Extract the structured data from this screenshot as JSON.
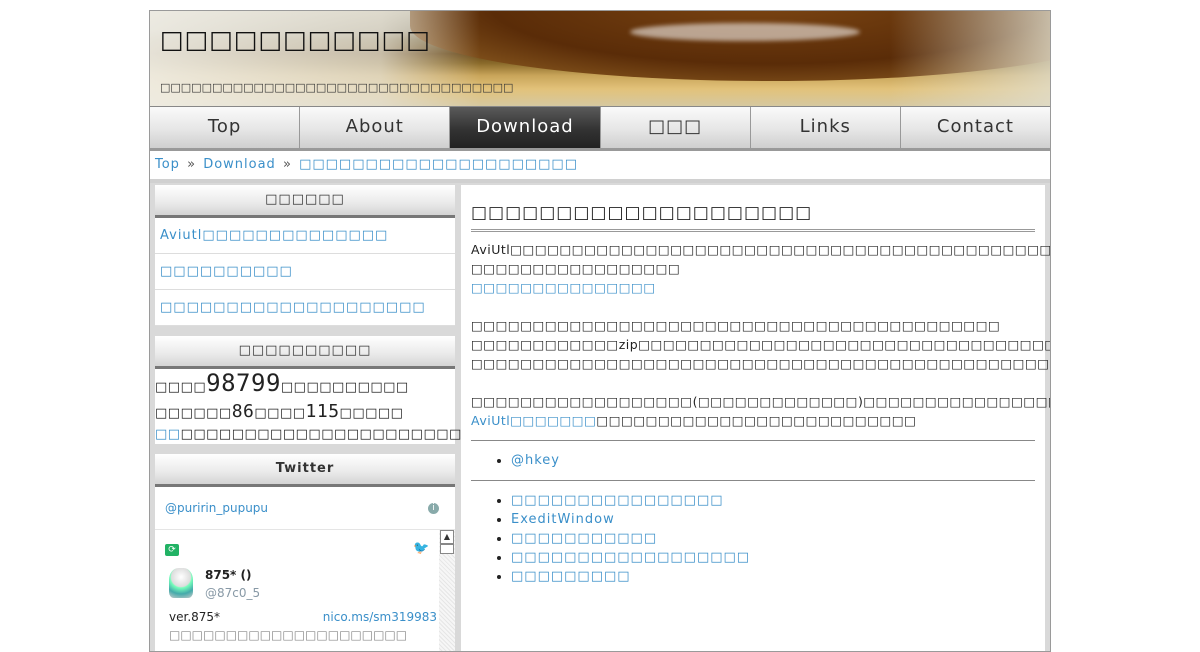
{
  "header": {
    "site_title": "□□□□□□□□□□□",
    "site_desc": "□□□□□□□□□□□□□□□□□□□□□□□□□□□□□□□□□□"
  },
  "nav": {
    "items": [
      "Top",
      "About",
      "Download",
      "□□□",
      "Links",
      "Contact"
    ],
    "active": "Download"
  },
  "breadcrumb": {
    "top": "Top",
    "download": "Download",
    "current": "□□□□□□□□□□□□□□□□□□□□□",
    "sep": "»"
  },
  "sidebar": {
    "categories": {
      "title": "□□□□□□",
      "links": [
        "Aviutl□□□□□□□□□□□□□□",
        "□□□□□□□□□□",
        "□□□□□□□□□□□□□□□□□□□□"
      ]
    },
    "counter": {
      "title": "□□□□□□□□□□",
      "prefix": "□□□□",
      "total": "98799",
      "total_suffix": "□□□□□□□□□□",
      "today_prefix": "□□□□□□",
      "today": "86",
      "yesterday_prefix": "□□□□",
      "yesterday": "115",
      "yesterday_suffix": "□□□□□",
      "link": "□□",
      "tail": "□□□□□□□□□□□□□□□□□□□□□□□□"
    },
    "twitter": {
      "title": "Twitter",
      "account": "@puririn_pupupu",
      "tweet": {
        "name": "875* ()",
        "handle": "@87c0_5",
        "text": "ver.875*",
        "link": "nico.ms/sm319983",
        "text2": "□□□□□□□□□□□□□□□□□□□□□"
      }
    }
  },
  "main": {
    "title": "□□□□□□□□□□□□□□□□□□□□",
    "p1_line1": "AviUtl□□□□□□□□□□□□□□□□□□□□□□□□□□□□□□□□□□□□□□□□□□□□□AviUtl□□□□□□□□□□□□□□□□□□□□",
    "p1_line2": "□□□□□□□□□□□□□□□□□",
    "p1_link": "□□□□□□□□□□□□□□□",
    "p2_line1": "□□□□□□□□□□□□□□□□□□□□□□□□□□□□□□□□□□□□□□□□□□□",
    "p2_line2": "□□□□□□□□□□□□zip□□□□□□□□□□□□□□□□□□□□□□□□□□□□□□□□□□□□□□□□□□□□□□□□□□□□□□□□□□□□□",
    "p2_line3": "□□□□□□□□□□□□□□□□□□□□□□□□□□□□□□□□□□□□□□□□□□□□□□□□□□□□□□",
    "p3_line1": "□□□□□□□□□□□□□□□□□□(□□□□□□□□□□□□□)□□□□□□□□□□□□□□□□□□□□□□□□□□□□□□□□□□□□□□□□□□□□□□□",
    "p3_link": "AviUtl□□□□□□□",
    "p3_tail": "□□□□□□□□□□□□□□□□□□□□□□□□□□",
    "author_link": "@hkey",
    "list": [
      "□□□□□□□□□□□□□□□□",
      "ExeditWindow",
      "□□□□□□□□□□□",
      "□□□□□□□□□□□□□□□□□□",
      "□□□□□□□□□"
    ]
  }
}
